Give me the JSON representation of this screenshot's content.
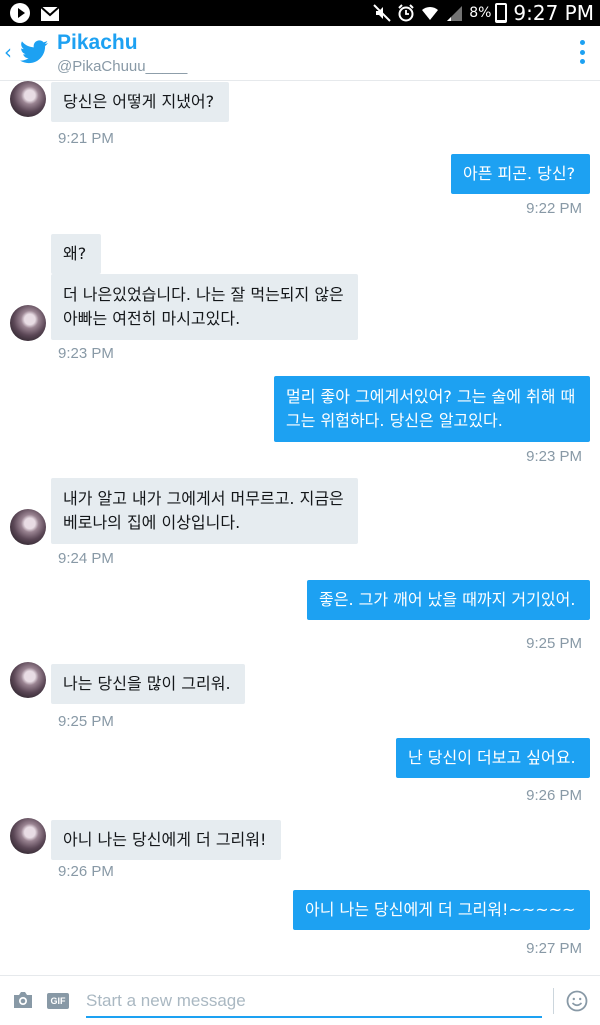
{
  "status_bar": {
    "battery_percent": "8%",
    "battery_level": 0.08,
    "time": "9:27 PM",
    "icons": [
      "play-icon",
      "mail-icon",
      "mute-icon",
      "alarm-icon",
      "wifi-icon",
      "signal-icon",
      "battery-icon"
    ]
  },
  "header": {
    "back_icon": "back-chevron-icon",
    "brand_icon": "twitter-bird-icon",
    "name": "Pikachu",
    "handle": "@PikaChuuu_____",
    "menu_icon": "more-vertical-icon",
    "accent": "#1da1f2"
  },
  "messages": [
    {
      "dir": "in",
      "lines": [
        "당신은 어떻게 지냈어?"
      ]
    },
    {
      "time": "9:21 PM"
    },
    {
      "dir": "out",
      "lines": [
        "아픈 피곤. 당신?"
      ]
    },
    {
      "time": "9:22 PM"
    },
    {
      "dir": "in",
      "lines": [
        "왜?"
      ]
    },
    {
      "dir": "in",
      "lines": [
        "더 나은있었습니다. 나는 잘 먹는되지 않은",
        "아빠는 여전히 마시고있다."
      ]
    },
    {
      "time": "9:23 PM"
    },
    {
      "dir": "out",
      "lines": [
        "멀리 좋아 그에게서있어? 그는 술에 취해 때",
        "그는 위험하다. 당신은 알고있다."
      ]
    },
    {
      "time": "9:23 PM"
    },
    {
      "dir": "in",
      "lines": [
        "내가 알고 내가 그에게서 머무르고. 지금은",
        "베로나의 집에 이상입니다."
      ]
    },
    {
      "time": "9:24 PM"
    },
    {
      "dir": "out",
      "lines": [
        "좋은. 그가 깨어 났을 때까지 거기있어."
      ]
    },
    {
      "time": "9:25 PM"
    },
    {
      "dir": "in",
      "lines": [
        "나는 당신을 많이 그리워."
      ]
    },
    {
      "time": "9:25 PM"
    },
    {
      "dir": "out",
      "lines": [
        "난 당신이 더보고 싶어요."
      ]
    },
    {
      "time": "9:26 PM"
    },
    {
      "dir": "in",
      "lines": [
        "아니 나는 당신에게 더 그리워!"
      ]
    },
    {
      "time": "9:26 PM"
    },
    {
      "dir": "out",
      "lines": [
        "아니 나는 당신에게 더 그리워!~~~~~"
      ]
    },
    {
      "time": "9:27 PM"
    }
  ],
  "composer": {
    "camera_icon": "camera-icon",
    "gif_label": "GIF",
    "placeholder": "Start a new message",
    "value": "",
    "emoji_icon": "emoji-icon"
  },
  "colors": {
    "incoming_bubble": "#e6ecf0",
    "outgoing_bubble": "#1da1f2",
    "timestamp": "#8899a6"
  }
}
